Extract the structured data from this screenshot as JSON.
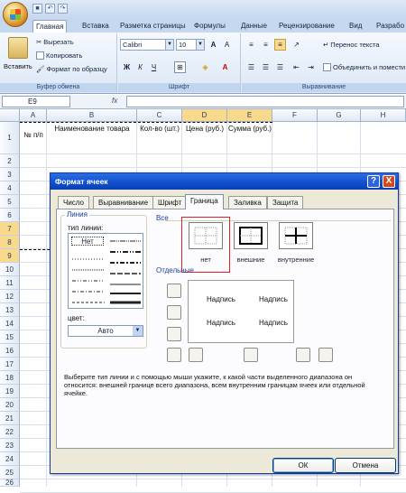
{
  "ribbon": {
    "tabs": [
      "Главная",
      "Вставка",
      "Разметка страницы",
      "Формулы",
      "Данные",
      "Рецензирование",
      "Вид",
      "Разрабо"
    ],
    "clipboard": {
      "paste": "Вставить",
      "cut": "Вырезать",
      "copy": "Копировать",
      "format_painter": "Формат по образцу",
      "title": "Буфер обмена"
    },
    "font": {
      "name": "Calibri",
      "size": "10",
      "title": "Шрифт"
    },
    "alignment": {
      "wrap": "Перенос текста",
      "merge": "Объединить и помести",
      "title": "Выравнивание"
    }
  },
  "formula_bar": {
    "cell_ref": "E9",
    "fx": "fx"
  },
  "sheet": {
    "columns": [
      "A",
      "B",
      "C",
      "D",
      "E",
      "F",
      "G",
      "H"
    ],
    "rows": [
      "1",
      "2",
      "3",
      "4",
      "5",
      "6",
      "7",
      "8",
      "9",
      "10",
      "11",
      "12",
      "13",
      "14",
      "15",
      "16",
      "17",
      "18",
      "19",
      "20",
      "21",
      "22",
      "23",
      "24",
      "25",
      "26"
    ],
    "headers": {
      "a": "№ п/п",
      "b": "Наименование товара",
      "c": "Кол-во (шт.)",
      "d": "Цена (руб.)",
      "e": "Сумма (руб.)"
    }
  },
  "dialog": {
    "title": "Формат ячеек",
    "help": "?",
    "close": "X",
    "tabs": [
      "Число",
      "Выравнивание",
      "Шрифт",
      "Граница",
      "Заливка",
      "Защита"
    ],
    "line_group": "Линия",
    "line_type_label": "тип линии:",
    "line_none": "Нет",
    "color_label": "цвет:",
    "color_value": "Авто",
    "all_label": "Все",
    "presets": [
      "нет",
      "внешние",
      "внутренние"
    ],
    "separate_label": "Отдельные",
    "preview_text": "Надпись",
    "hint": "Выберите тип линии и с помощью мыши укажите, к какой части выделенного диапазона он относится: внешней границе всего диапазона, всем внутренним границам ячеек или отдельной ячейке.",
    "ok": "ОК",
    "cancel": "Отмена"
  }
}
